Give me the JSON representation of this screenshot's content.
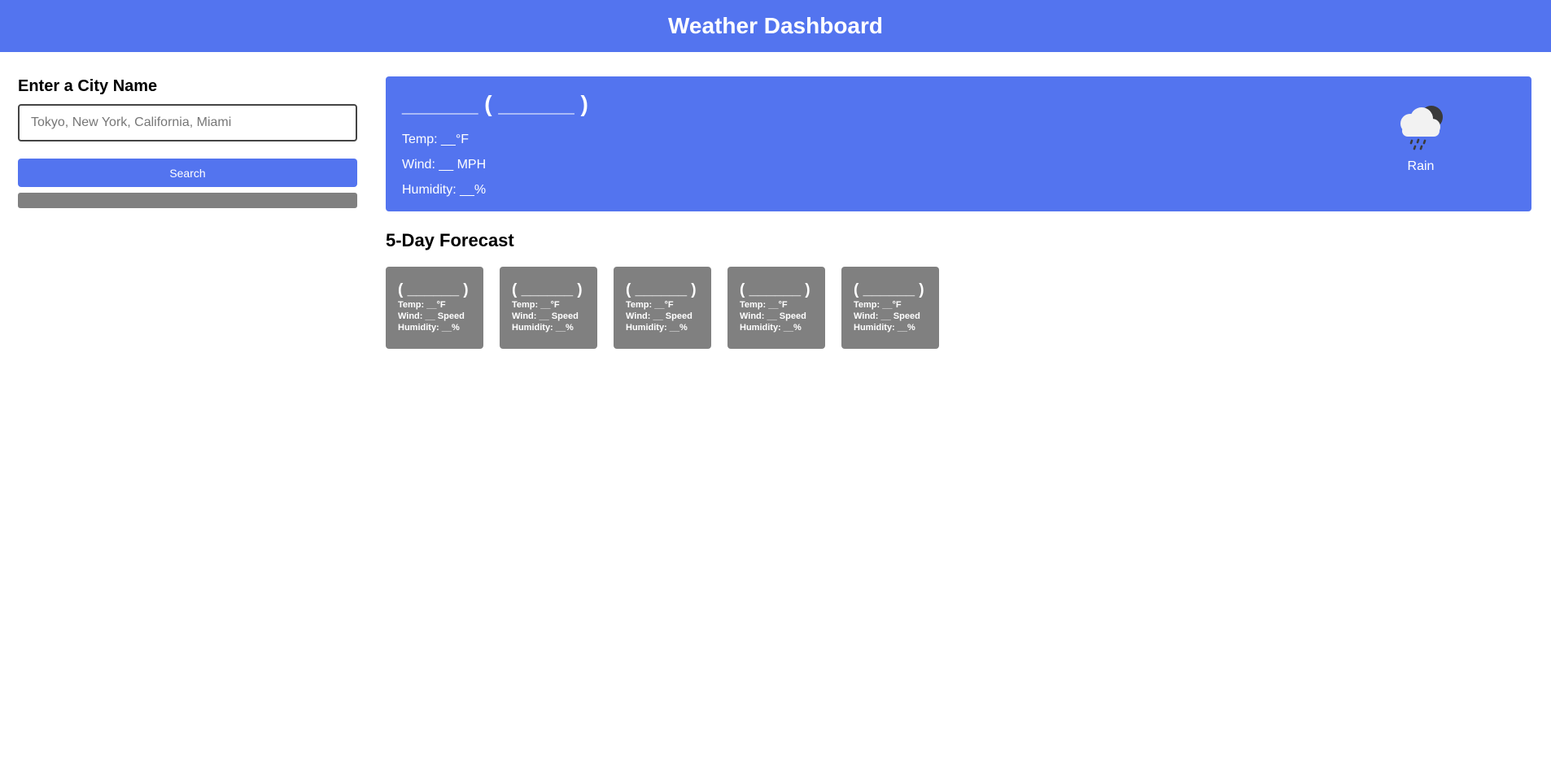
{
  "header": {
    "title": "Weather Dashboard"
  },
  "sidebar": {
    "title": "Enter a City Name",
    "search_placeholder": "Tokyo, New York, California, Miami",
    "search_value": "",
    "search_label": "Search"
  },
  "current": {
    "title": "______ ( ______ )",
    "temp": "Temp: __°F",
    "wind": "Wind: __ MPH",
    "humidity": "Humidity: __%",
    "icon": "rain-cloud-icon",
    "description": "Rain"
  },
  "forecast": {
    "title": "5-Day Forecast",
    "days": [
      {
        "date": "( ______ )",
        "temp": "Temp: __°F",
        "wind": "Wind: __ Speed",
        "humidity": "Humidity: __%"
      },
      {
        "date": "( ______ )",
        "temp": "Temp: __°F",
        "wind": "Wind: __ Speed",
        "humidity": "Humidity: __%"
      },
      {
        "date": "( ______ )",
        "temp": "Temp: __°F",
        "wind": "Wind: __ Speed",
        "humidity": "Humidity: __%"
      },
      {
        "date": "( ______ )",
        "temp": "Temp: __°F",
        "wind": "Wind: __ Speed",
        "humidity": "Humidity: __%"
      },
      {
        "date": "( ______ )",
        "temp": "Temp: __°F",
        "wind": "Wind: __ Speed",
        "humidity": "Humidity: __%"
      }
    ]
  },
  "colors": {
    "accent": "#5374ef",
    "card_gray": "#808080"
  }
}
